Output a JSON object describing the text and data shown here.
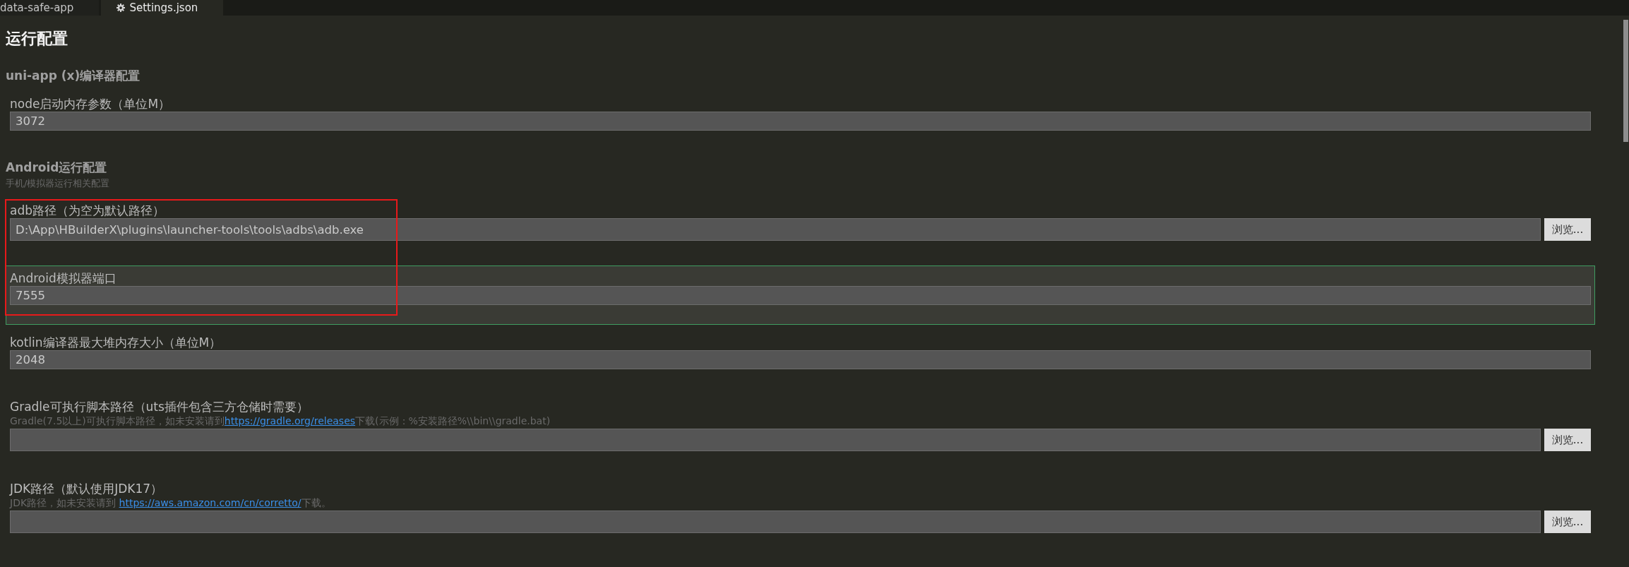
{
  "tabs": [
    {
      "label": "data-safe-app",
      "selected": false,
      "kind": "file"
    },
    {
      "label": "Settings.json",
      "selected": true,
      "kind": "settings"
    }
  ],
  "title": "运行配置",
  "sections": [
    {
      "title": "uni-app (x)编译器配置",
      "settings": [
        {
          "label": "node启动内存参数（单位M）",
          "value": "3072",
          "highlighted": false,
          "annotated": false
        }
      ]
    },
    {
      "title": "Android运行配置",
      "subtitle": "手机/模拟器运行相关配置",
      "settings": [
        {
          "label": "adb路径（为空为默认路径）",
          "value": "D:\\App\\HBuilderX\\plugins\\launcher-tools\\tools\\adbs\\adb.exe",
          "browse_button": "浏览...",
          "highlighted": false,
          "annotated": true
        },
        {
          "label": "Android模拟器端口",
          "value": "7555",
          "highlighted": true,
          "annotated": true
        },
        {
          "label": "kotlin编译器最大堆内存大小（单位M）",
          "value": "2048",
          "highlighted": false,
          "annotated": false
        },
        {
          "label": "Gradle可执行脚本路径（uts插件包含三方仓储时需要）",
          "description": [
            {
              "kind": "text",
              "text": "Gradle(7.5以上)可执行脚本路径，如未安装请到"
            },
            {
              "kind": "link",
              "text": "https://gradle.org/releases"
            },
            {
              "kind": "text",
              "text": "下载(示例：%安装路径%\\\\bin\\\\gradle.bat)"
            }
          ],
          "browse_button": "浏览...",
          "highlighted": false,
          "annotated": false
        },
        {
          "label": "JDK路径（默认使用JDK17）",
          "description": [
            {
              "kind": "text",
              "text": "JDK路径，如未安装请到 "
            },
            {
              "kind": "link",
              "text": "https://aws.amazon.com/cn/corretto/"
            },
            {
              "kind": "text",
              "text": "下载。"
            }
          ],
          "browse_button": "浏览...",
          "highlighted": false,
          "annotated": false
        }
      ]
    }
  ]
}
